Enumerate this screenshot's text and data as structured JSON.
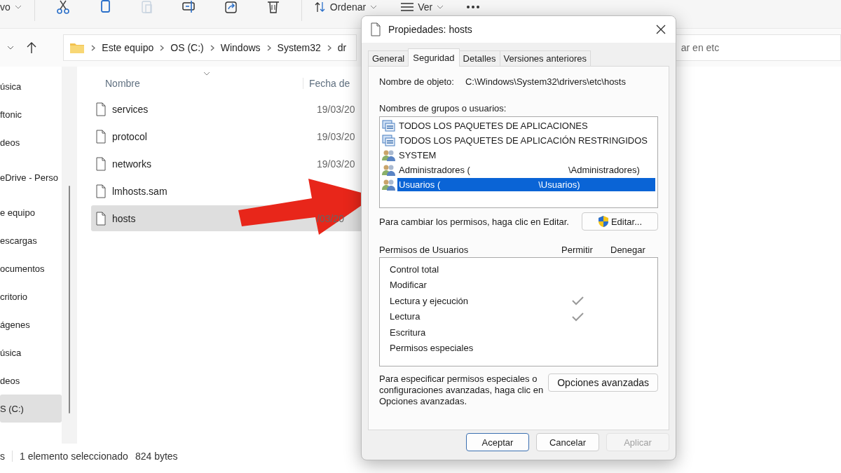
{
  "explorer": {
    "toolbar": {
      "new_label": "vo",
      "sort_label": "Ordenar",
      "view_label": "Ver"
    },
    "breadcrumb": [
      "Este equipo",
      "OS (C:)",
      "Windows",
      "System32",
      "dr"
    ],
    "search": {
      "placeholder": "ar en etc"
    },
    "sidebar": {
      "sections": [
        {
          "items": [
            {
              "label": "úsica",
              "selected": false
            },
            {
              "label": "ftonic",
              "selected": false
            },
            {
              "label": "deos",
              "selected": false
            }
          ]
        },
        {
          "items": [
            {
              "label": "eDrive - Perso",
              "selected": false
            }
          ]
        },
        {
          "items": [
            {
              "label": "e equipo",
              "selected": false
            },
            {
              "label": "escargas",
              "selected": false
            },
            {
              "label": "ocumentos",
              "selected": false
            },
            {
              "label": "critorio",
              "selected": false
            },
            {
              "label": "ágenes",
              "selected": false
            },
            {
              "label": "úsica",
              "selected": false
            },
            {
              "label": "deos",
              "selected": false
            },
            {
              "label": "S (C:)",
              "selected": true
            }
          ]
        }
      ]
    },
    "files": {
      "columns": [
        "Nombre",
        "Fecha de"
      ],
      "rows": [
        {
          "name": "services",
          "date": "19/03/20",
          "selected": false
        },
        {
          "name": "protocol",
          "date": "19/03/20",
          "selected": false
        },
        {
          "name": "networks",
          "date": "19/03/20",
          "selected": false
        },
        {
          "name": "lmhosts.sam",
          "date": "",
          "selected": false
        },
        {
          "name": "hosts",
          "date": "/03/20",
          "selected": true
        }
      ]
    },
    "status_bar": {
      "count": "s",
      "selection": "1 elemento seleccionado",
      "size": "824 bytes"
    }
  },
  "dialog": {
    "title": "Propiedades: hosts",
    "tabs": [
      {
        "label": "General",
        "selected": false
      },
      {
        "label": "Seguridad",
        "selected": true
      },
      {
        "label": "Detalles",
        "selected": false
      },
      {
        "label": "Versiones anteriores",
        "selected": false
      }
    ],
    "object_label": "Nombre de objeto:",
    "object_value": "C:\\Windows\\System32\\drivers\\etc\\hosts",
    "groups_label": "Nombres de grupos o usuarios:",
    "groups": [
      {
        "kind": "package",
        "parts": [
          "TODOS LOS PAQUETES DE APLICACIONES"
        ],
        "selected": false
      },
      {
        "kind": "package",
        "parts": [
          "TODOS LOS PAQUETES DE APLICACIÓN RESTRINGIDOS"
        ],
        "selected": false
      },
      {
        "kind": "users",
        "parts": [
          "SYSTEM"
        ],
        "selected": false
      },
      {
        "kind": "users",
        "parts": [
          "Administradores (",
          "\\Administradores)"
        ],
        "selected": false
      },
      {
        "kind": "users",
        "parts": [
          "Usuarios (",
          "\\Usuarios)"
        ],
        "selected": true
      }
    ],
    "edit_hint": "Para cambiar los permisos, haga clic en Editar.",
    "edit_button": "Editar...",
    "permissions": {
      "title": "Permisos de Usuarios",
      "allow_label": "Permitir",
      "deny_label": "Denegar",
      "rows": [
        {
          "name": "Control total",
          "allow": false,
          "deny": false
        },
        {
          "name": "Modificar",
          "allow": false,
          "deny": false
        },
        {
          "name": "Lectura y ejecución",
          "allow": true,
          "deny": false
        },
        {
          "name": "Lectura",
          "allow": true,
          "deny": false
        },
        {
          "name": "Escritura",
          "allow": false,
          "deny": false
        },
        {
          "name": "Permisos especiales",
          "allow": false,
          "deny": false
        }
      ]
    },
    "advanced_hint": "Para especificar permisos especiales o configuraciones avanzadas, haga clic en Opciones avanzadas.",
    "advanced_button": "Opciones avanzadas",
    "buttons": [
      {
        "label": "Aceptar",
        "default": true,
        "disabled": false
      },
      {
        "label": "Cancelar",
        "default": false,
        "disabled": false
      },
      {
        "label": "Aplicar",
        "default": false,
        "disabled": true
      }
    ]
  }
}
